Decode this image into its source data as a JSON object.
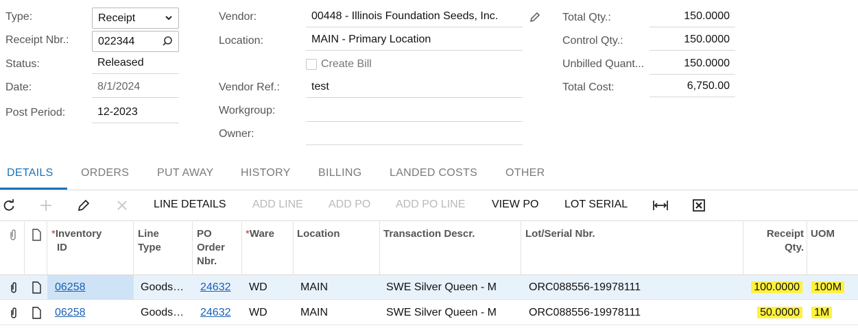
{
  "header": {
    "type_label": "Type:",
    "type_value": "Receipt",
    "receipt_nbr_label": "Receipt Nbr.:",
    "receipt_nbr_value": "022344",
    "status_label": "Status:",
    "status_value": "Released",
    "date_label": "Date:",
    "date_value": "8/1/2024",
    "post_period_label": "Post Period:",
    "post_period_value": "12-2023",
    "vendor_label": "Vendor:",
    "vendor_value": "00448 - Illinois Foundation Seeds, Inc.",
    "location_label": "Location:",
    "location_value": "MAIN - Primary Location",
    "create_bill_label": "Create Bill",
    "vendor_ref_label": "Vendor Ref.:",
    "vendor_ref_value": "test",
    "workgroup_label": "Workgroup:",
    "workgroup_value": "",
    "owner_label": "Owner:",
    "owner_value": "",
    "total_qty_label": "Total Qty.:",
    "total_qty_value": "150.0000",
    "control_qty_label": "Control Qty.:",
    "control_qty_value": "150.0000",
    "unbilled_qty_label": "Unbilled Quant...",
    "unbilled_qty_value": "150.0000",
    "total_cost_label": "Total Cost:",
    "total_cost_value": "6,750.00"
  },
  "tabs": [
    "DETAILS",
    "ORDERS",
    "PUT AWAY",
    "HISTORY",
    "BILLING",
    "LANDED COSTS",
    "OTHER"
  ],
  "toolbar": {
    "line_details": "LINE DETAILS",
    "add_line": "ADD LINE",
    "add_po": "ADD PO",
    "add_po_line": "ADD PO LINE",
    "view_po": "VIEW PO",
    "lot_serial": "LOT SERIAL"
  },
  "grid": {
    "columns": {
      "inventory_id_1": "Inventory",
      "inventory_id_2": "ID",
      "line_type_1": "Line",
      "line_type_2": "Type",
      "po_order_1": "PO",
      "po_order_2": "Order",
      "po_order_3": "Nbr.",
      "warehouse": "Ware",
      "location": "Location",
      "transaction_descr": "Transaction Descr.",
      "lot_serial_nbr": "Lot/Serial Nbr.",
      "receipt_qty_1": "Receipt",
      "receipt_qty_2": "Qty.",
      "uom": "UOM"
    },
    "rows": [
      {
        "inventory_id": "06258",
        "line_type": "Goods…",
        "po_order_nbr": "24632",
        "warehouse": "WD",
        "location": "MAIN",
        "transaction_descr": "SWE Silver Queen - M",
        "lot_serial_nbr": "ORC088556-19978111",
        "receipt_qty": "100.0000",
        "uom": "100M"
      },
      {
        "inventory_id": "06258",
        "line_type": "Goods…",
        "po_order_nbr": "24632",
        "warehouse": "WD",
        "location": "MAIN",
        "transaction_descr": "SWE Silver Queen - M",
        "lot_serial_nbr": "ORC088556-19978111",
        "receipt_qty": "50.0000",
        "uom": "1M"
      }
    ]
  },
  "colors": {
    "accent": "#1a73b8",
    "highlight": "#fff23d",
    "selected_row": "#e8f2fb"
  }
}
